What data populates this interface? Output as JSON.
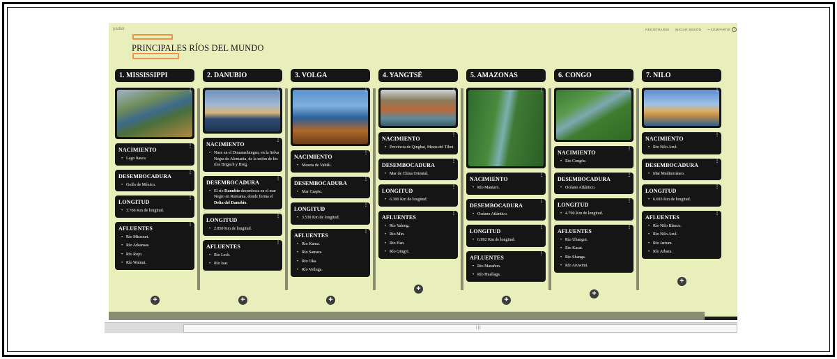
{
  "padlet": {
    "brand": "padlet",
    "nav": {
      "register": "REGISTRARSE",
      "login": "INICIAR SESIÓN",
      "share": "COMPARTIR",
      "help": "?"
    },
    "title": "PRINCIPALES RÍOS DEL MUNDO"
  },
  "columns": [
    {
      "header": "1. MISSISSIPPI",
      "image": "river-valley-photo",
      "cards": [
        {
          "title": "NACIMIENTO",
          "items": [
            "Lago Itasca."
          ]
        },
        {
          "title": "DESEMBOCADURA",
          "items": [
            "Golfo de México."
          ]
        },
        {
          "title": "LONGITUD",
          "items": [
            "3.766 Km de longitud."
          ]
        },
        {
          "title": "AFLUENTES",
          "items": [
            "Río Missouri.",
            "Río Arkansas.",
            "Río Rojo.",
            "Río Walnut."
          ]
        }
      ]
    },
    {
      "header": "2. DANUBIO",
      "image": "city-river-bridge-photo",
      "cards": [
        {
          "title": "NACIMIENTO",
          "items": [
            "Nace en el Donauschingen, en la Selva Negra de Alemania, de la unión de los ríos Brigach y Breg."
          ]
        },
        {
          "title": "DESEMBOCADURA",
          "items": [
            "El río Danubio desemboca en el mar Negro en Rumania, donde forma el Delta del Danubio."
          ]
        },
        {
          "title": "LONGITUD",
          "items": [
            "2.850 Km de longitud."
          ]
        },
        {
          "title": "AFLUENTES",
          "items": [
            "Río Lech.",
            "Río Isar."
          ]
        }
      ]
    },
    {
      "header": "3. VOLGA",
      "image": "blue-river-autumn-photo",
      "cards": [
        {
          "title": "NACIMIENTO",
          "items": [
            "Meseta de Valdái."
          ]
        },
        {
          "title": "DESEMBOCADURA",
          "items": [
            "Mar Caspio."
          ]
        },
        {
          "title": "LONGITUD",
          "items": [
            "3.530 Km de longitud."
          ]
        },
        {
          "title": "AFLUENTES",
          "items": [
            "Río Kama.",
            "Río Samara.",
            "Río Oka.",
            "Río Vetluga."
          ]
        }
      ]
    },
    {
      "header": "4. YANGTSÉ",
      "image": "gorge-river-photo",
      "cards": [
        {
          "title": "NACIMIENTO",
          "items": [
            "Provincia de Qinghai, Mesta del Tibet."
          ]
        },
        {
          "title": "DESEMBOCADURA",
          "items": [
            "Mar de China Oriental."
          ]
        },
        {
          "title": "LONGITUD",
          "items": [
            "6.300 Km de longitud."
          ]
        },
        {
          "title": "AFLUENTES",
          "items": [
            "Río Yalong.",
            "Río Min.",
            "Río Han.",
            "Río Qingyi."
          ]
        }
      ]
    },
    {
      "header": "5. AMAZONAS",
      "image": "rainforest-river-photo",
      "cards": [
        {
          "title": "NACIMIENTO",
          "items": [
            "Río Mantaro."
          ]
        },
        {
          "title": "DESEMBOCADURA",
          "items": [
            "Océano Atlántico."
          ]
        },
        {
          "title": "LONGITUD",
          "items": [
            "6.992 Km de longitud."
          ]
        },
        {
          "title": "AFLUENTES",
          "items": [
            "Río Marañon.",
            "Río Huallaga."
          ]
        }
      ]
    },
    {
      "header": "6. CONGO",
      "image": "jungle-river-bend-photo",
      "cards": [
        {
          "title": "NACIMIENTO",
          "items": [
            "Río Congõe."
          ]
        },
        {
          "title": "DESEMBOCADURA",
          "items": [
            "Océano Atlántico."
          ]
        },
        {
          "title": "LONGITUD",
          "items": [
            "4.700 Km de longitud."
          ]
        },
        {
          "title": "AFLUENTES",
          "items": [
            "Río Ubangui.",
            "Río Kasai.",
            "Río Shanga.",
            "Río Aruwimi."
          ]
        }
      ]
    },
    {
      "header": "7. NILO",
      "image": "desert-river-photo",
      "cards": [
        {
          "title": "NACIMIENTO",
          "items": [
            "Río Nilo Azul."
          ]
        },
        {
          "title": "DESEMBOCADURA",
          "items": [
            "Mar Mediterráneo."
          ]
        },
        {
          "title": "LONGITUD",
          "items": [
            "6.693 Km de longitud."
          ]
        },
        {
          "title": "AFLUENTES",
          "items": [
            "Río Nilo Blanco.",
            "Río Nilo Azul.",
            "Río Jartum.",
            "Río Atbara."
          ]
        }
      ]
    }
  ],
  "ui": {
    "add_symbol": "+",
    "more_symbol": "⋮",
    "scroll_grip": "|||"
  }
}
